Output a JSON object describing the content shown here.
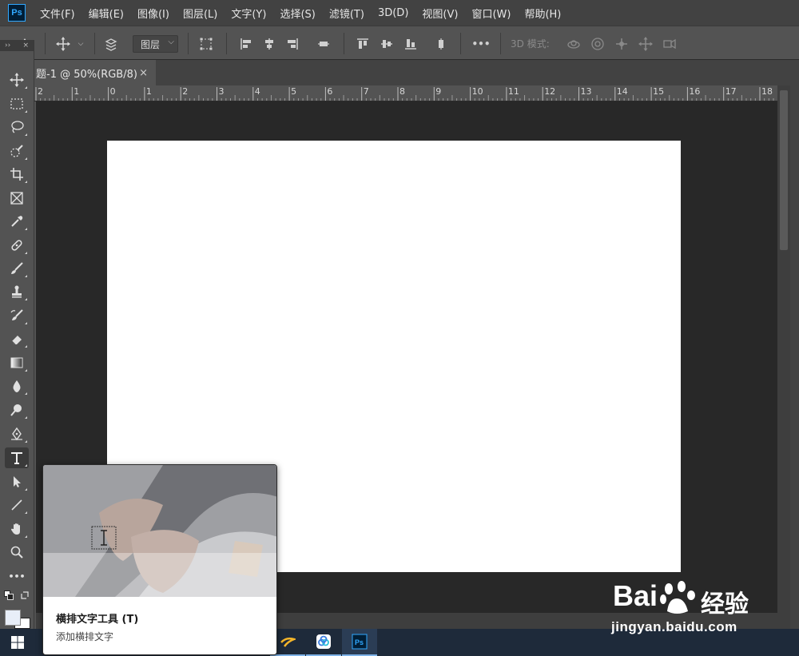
{
  "app": {
    "logo": "Ps"
  },
  "menu": [
    "文件(F)",
    "编辑(E)",
    "图像(I)",
    "图层(L)",
    "文字(Y)",
    "选择(S)",
    "滤镜(T)",
    "3D(D)",
    "视图(V)",
    "窗口(W)",
    "帮助(H)"
  ],
  "options": {
    "layer_select": "图层",
    "mode_3d_label": "3D 模式:",
    "more": "•••"
  },
  "toolbar": {
    "collapse": "››",
    "close": "×"
  },
  "document": {
    "tab_title": "题-1 @ 50%(RGB/8)",
    "close": "×"
  },
  "ruler": {
    "ticks": [
      "2",
      "1",
      "0",
      "1",
      "2",
      "3",
      "4",
      "5",
      "6",
      "7",
      "8",
      "9",
      "10",
      "11",
      "12",
      "13",
      "14",
      "15",
      "16",
      "17",
      "18"
    ]
  },
  "tooltip": {
    "title": "横排文字工具 (T)",
    "description": "添加横排文字"
  },
  "watermark": {
    "logo_text": "Bai",
    "logo_cn": "经验",
    "url": "jingyan.baidu.com"
  },
  "colors": {
    "menubar": "#424242",
    "panel": "#535353",
    "workspace": "#282828",
    "canvas": "#ffffff",
    "accent": "#31a8ff"
  }
}
